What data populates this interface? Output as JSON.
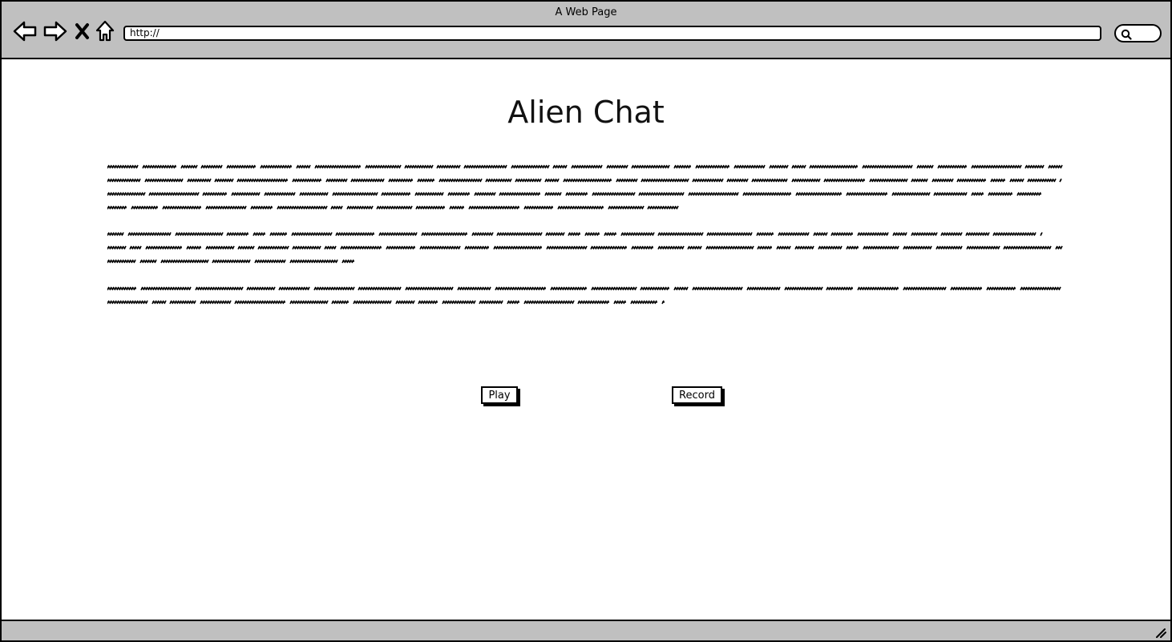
{
  "window": {
    "title": "A Web Page"
  },
  "toolbar": {
    "back_icon": "back-arrow-icon",
    "forward_icon": "forward-arrow-icon",
    "stop_icon": "close-icon",
    "home_icon": "home-icon",
    "url_value": "http://",
    "search_icon": "search-icon"
  },
  "page": {
    "title": "Alien Chat",
    "play_label": "Play",
    "record_label": "Record"
  },
  "colors": {
    "chrome": "#c0c0c0",
    "border": "#000000",
    "background": "#ffffff"
  }
}
